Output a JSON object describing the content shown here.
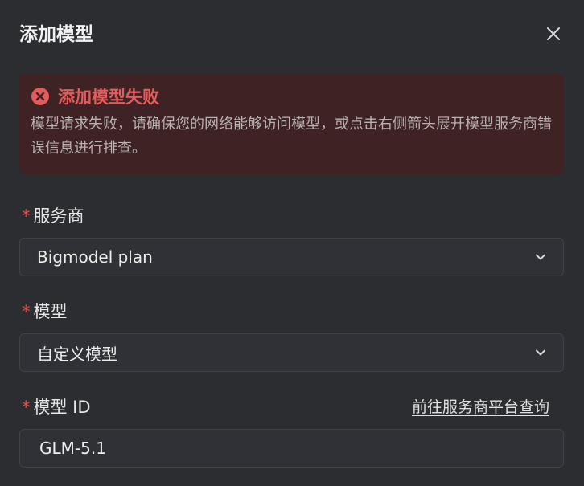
{
  "dialog": {
    "title": "添加模型"
  },
  "alert": {
    "title": "添加模型失败",
    "message": "模型请求失败，请确保您的网络能够访问模型，或点击右侧箭头展开模型服务商错误信息进行排查。",
    "color": "#e35b5b"
  },
  "provider": {
    "required_mark": "*",
    "label": "服务商",
    "selected": "Bigmodel plan"
  },
  "model": {
    "required_mark": "*",
    "label": "模型",
    "selected": "自定义模型"
  },
  "model_id": {
    "required_mark": "*",
    "label": "模型 ID",
    "link": "前往服务商平台查询",
    "value": "GLM-5.1"
  },
  "icons": {
    "close": "close-icon",
    "error": "error-circle-icon",
    "dropdown": "chevron-down-icon"
  }
}
